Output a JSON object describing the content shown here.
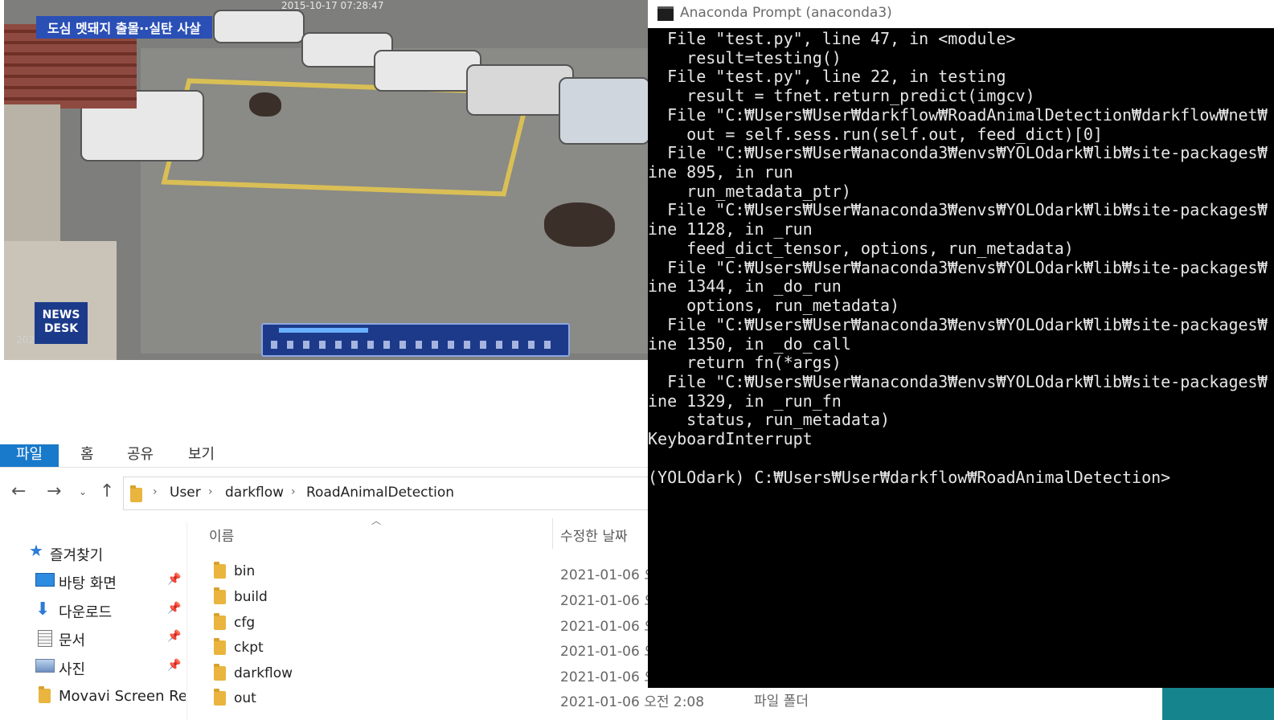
{
  "video": {
    "caption": "도심 멧돼지 출몰··실탄 사살",
    "timestamp": "2015-10-17 07:28:47",
    "logo_line1": "NEWS",
    "logo_line2": "DESK",
    "year_fragment": "202",
    "player_progress": 0.3
  },
  "explorer": {
    "ribbon_tabs": [
      "파일",
      "홈",
      "공유",
      "보기"
    ],
    "address_segments": [
      "User",
      "darkflow",
      "RoadAnimalDetection"
    ],
    "nav_items": [
      {
        "label": "즐겨찾기"
      },
      {
        "label": "바탕 화면",
        "pinned": true
      },
      {
        "label": "다운로드",
        "pinned": true
      },
      {
        "label": "문서",
        "pinned": true
      },
      {
        "label": "사진",
        "pinned": true
      },
      {
        "label": "Movavi Screen Rec"
      }
    ],
    "columns": {
      "name": "이름",
      "date": "수정한 날짜"
    },
    "files": [
      {
        "name": "bin",
        "date": "2021-01-06 오",
        "type": ""
      },
      {
        "name": "build",
        "date": "2021-01-06 오",
        "type": ""
      },
      {
        "name": "cfg",
        "date": "2021-01-06 오",
        "type": ""
      },
      {
        "name": "ckpt",
        "date": "2021-01-06 오",
        "type": ""
      },
      {
        "name": "darkflow",
        "date": "2021-01-06 오",
        "type": ""
      },
      {
        "name": "out",
        "date": "2021-01-06 오전 2:08",
        "type": "파일 폴더"
      }
    ]
  },
  "console": {
    "title": "Anaconda Prompt (anaconda3)",
    "lines": [
      "  File \"test.py\", line 47, in <module>",
      "    result=testing()",
      "  File \"test.py\", line 22, in testing",
      "    result = tfnet.return_predict(imgcv)",
      "  File \"C:₩Users₩User₩darkflow₩RoadAnimalDetection₩darkflow₩net₩",
      "    out = self.sess.run(self.out, feed_dict)[0]",
      "  File \"C:₩Users₩User₩anaconda3₩envs₩YOLOdark₩lib₩site-packages₩",
      "ine 895, in run",
      "    run_metadata_ptr)",
      "  File \"C:₩Users₩User₩anaconda3₩envs₩YOLOdark₩lib₩site-packages₩",
      "ine 1128, in _run",
      "    feed_dict_tensor, options, run_metadata)",
      "  File \"C:₩Users₩User₩anaconda3₩envs₩YOLOdark₩lib₩site-packages₩",
      "ine 1344, in _do_run",
      "    options, run_metadata)",
      "  File \"C:₩Users₩User₩anaconda3₩envs₩YOLOdark₩lib₩site-packages₩",
      "ine 1350, in _do_call",
      "    return fn(*args)",
      "  File \"C:₩Users₩User₩anaconda3₩envs₩YOLOdark₩lib₩site-packages₩",
      "ine 1329, in _run_fn",
      "    status, run_metadata)",
      "KeyboardInterrupt",
      "",
      "(YOLOdark) C:₩Users₩User₩darkflow₩RoadAnimalDetection>"
    ]
  },
  "colors": {
    "ribbon_active": "#1979ca",
    "console_bg": "#000000",
    "console_fg": "#e6e6e6",
    "caption_bg": "#2a4fb5",
    "taskbar": "#16848c"
  }
}
